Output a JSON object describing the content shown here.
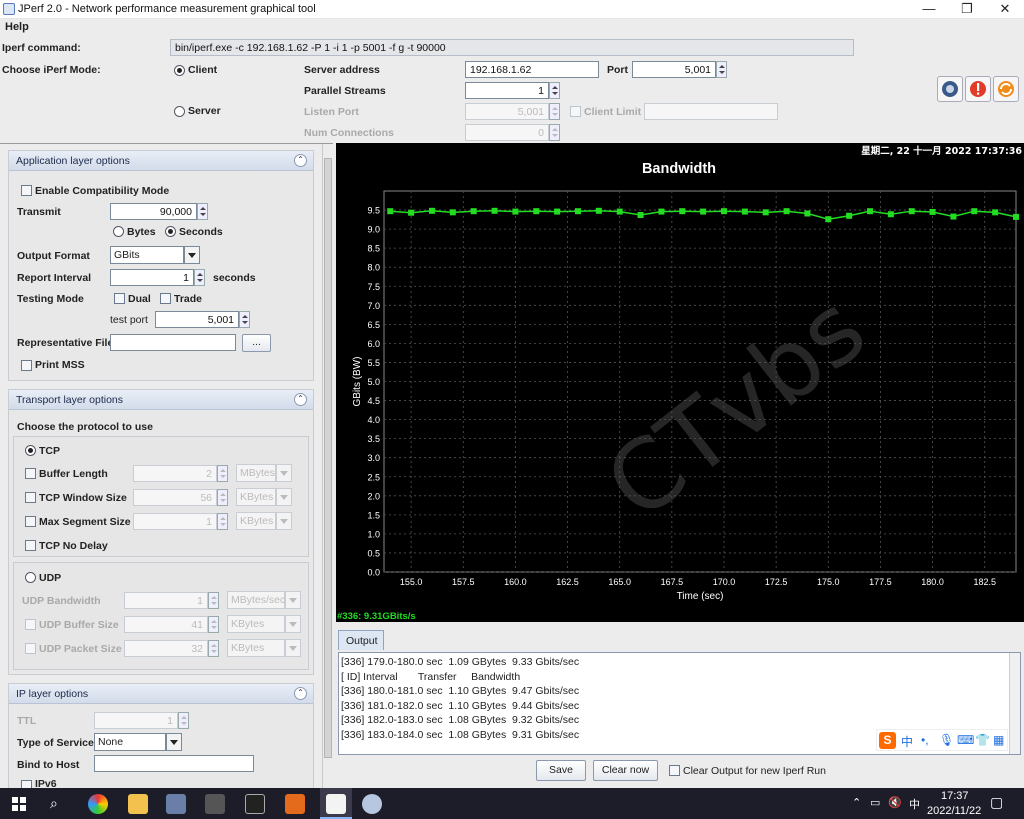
{
  "window": {
    "title": "JPerf 2.0 - Network performance measurement graphical tool",
    "minimize": "—",
    "maximize": "❐",
    "close": "✕"
  },
  "menu": {
    "help": "Help"
  },
  "config": {
    "command_label": "Iperf command:",
    "command_value": "bin/iperf.exe -c 192.168.1.62 -P 1 -i 1 -p 5001 -f g -t 90000",
    "mode_label": "Choose iPerf Mode:",
    "client_label": "Client",
    "server_label": "Server",
    "server_address_label": "Server address",
    "server_address_value": "192.168.1.62",
    "port_label": "Port",
    "port_value": "5,001",
    "parallel_label": "Parallel Streams",
    "parallel_value": "1",
    "listen_port_label": "Listen Port",
    "listen_port_value": "5,001",
    "client_limit_label": "Client Limit",
    "num_conn_label": "Num Connections",
    "num_conn_value": "0"
  },
  "app_options": {
    "title": "Application layer options",
    "compat_label": "Enable Compatibility Mode",
    "transmit_label": "Transmit",
    "transmit_value": "90,000",
    "bytes_label": "Bytes",
    "seconds_label": "Seconds",
    "output_format_label": "Output Format",
    "output_format_value": "GBits",
    "report_interval_label": "Report Interval",
    "report_interval_value": "1",
    "report_interval_unit": "seconds",
    "testing_mode_label": "Testing Mode",
    "dual_label": "Dual",
    "trade_label": "Trade",
    "test_port_label": "test port",
    "test_port_value": "5,001",
    "rep_file_label": "Representative File",
    "browse_label": "...",
    "print_mss_label": "Print MSS"
  },
  "transport_options": {
    "title": "Transport layer options",
    "protocol_label": "Choose the protocol to use",
    "tcp_label": "TCP",
    "buffer_length_label": "Buffer Length",
    "buffer_length_value": "2",
    "buffer_length_unit": "MBytes",
    "tcp_window_label": "TCP Window Size",
    "tcp_window_value": "56",
    "tcp_window_unit": "KBytes",
    "max_seg_label": "Max Segment Size",
    "max_seg_value": "1",
    "max_seg_unit": "KBytes",
    "no_delay_label": "TCP No Delay",
    "udp_label": "UDP",
    "udp_bw_label": "UDP Bandwidth",
    "udp_bw_value": "1",
    "udp_bw_unit": "MBytes/sec",
    "udp_buf_label": "UDP Buffer Size",
    "udp_buf_value": "41",
    "udp_buf_unit": "KBytes",
    "udp_pkt_label": "UDP Packet Size",
    "udp_pkt_value": "32",
    "udp_pkt_unit": "KBytes"
  },
  "ip_options": {
    "title": "IP layer options",
    "ttl_label": "TTL",
    "ttl_value": "1",
    "tos_label": "Type of Service",
    "tos_value": "None",
    "bind_label": "Bind to Host",
    "ipv6_label": "IPv6"
  },
  "chart_data": {
    "type": "line",
    "title": "Bandwidth",
    "timestamp": "星期二, 22 十一月 2022 17:37:36",
    "xlabel": "Time (sec)",
    "ylabel": "GBits (BW)",
    "xlim": [
      153.7,
      184.0
    ],
    "ylim": [
      0.0,
      10.0
    ],
    "xticks": [
      "155.0",
      "157.5",
      "160.0",
      "162.5",
      "165.0",
      "167.5",
      "170.0",
      "172.5",
      "175.0",
      "177.5",
      "180.0",
      "182.5"
    ],
    "yticks": [
      "0.0",
      "0.5",
      "1.0",
      "1.5",
      "2.0",
      "2.5",
      "3.0",
      "3.5",
      "4.0",
      "4.5",
      "5.0",
      "5.5",
      "6.0",
      "6.5",
      "7.0",
      "7.5",
      "8.0",
      "8.5",
      "9.0",
      "9.5"
    ],
    "grid": true,
    "series": [
      {
        "name": "#336: 9.31GBits/s",
        "color": "#22dd22",
        "x": [
          154,
          155,
          156,
          157,
          158,
          159,
          160,
          161,
          162,
          163,
          164,
          165,
          166,
          167,
          168,
          169,
          170,
          171,
          172,
          173,
          174,
          175,
          176,
          177,
          178,
          179,
          180,
          181,
          182,
          183,
          184
        ],
        "y": [
          9.47,
          9.43,
          9.48,
          9.44,
          9.47,
          9.48,
          9.46,
          9.47,
          9.46,
          9.47,
          9.48,
          9.46,
          9.37,
          9.46,
          9.47,
          9.46,
          9.47,
          9.46,
          9.44,
          9.47,
          9.41,
          9.26,
          9.35,
          9.47,
          9.39,
          9.47,
          9.45,
          9.33,
          9.47,
          9.44,
          9.32
        ]
      }
    ],
    "watermark": "CTvbs"
  },
  "output": {
    "tab_label": "Output",
    "lines": [
      "[336] 179.0-180.0 sec  1.09 GBytes  9.33 Gbits/sec",
      "[ ID] Interval       Transfer     Bandwidth",
      "[336] 180.0-181.0 sec  1.10 GBytes  9.47 Gbits/sec",
      "[336] 181.0-182.0 sec  1.10 GBytes  9.44 Gbits/sec",
      "[336] 182.0-183.0 sec  1.08 GBytes  9.32 Gbits/sec",
      "[336] 183.0-184.0 sec  1.08 GBytes  9.31 Gbits/sec"
    ],
    "save_label": "Save",
    "clear_label": "Clear now",
    "clear_new_run_label": "Clear Output for new Iperf Run",
    "ime_label": "中"
  },
  "taskbar": {
    "time": "17:37",
    "date": "2022/11/22",
    "ime": "中"
  }
}
